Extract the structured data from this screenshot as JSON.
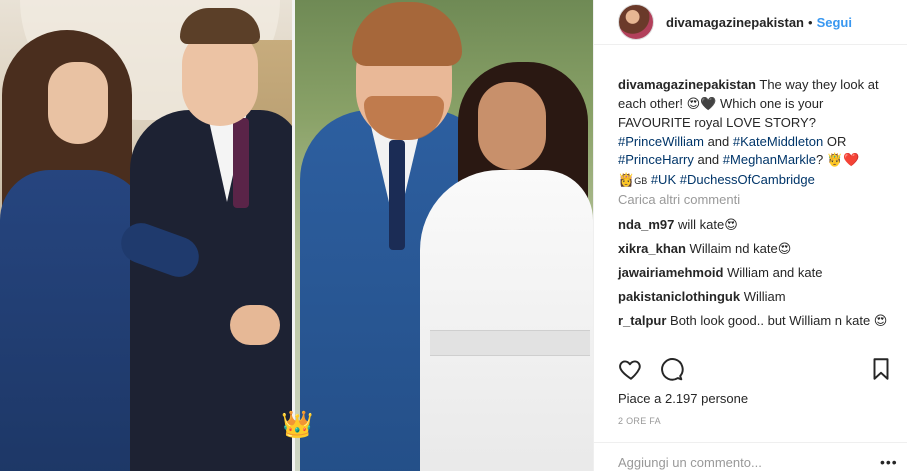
{
  "post": {
    "username": "divamagazinepakistan",
    "dot": "•",
    "follow_label": "Segui",
    "crown_emoji": "👑"
  },
  "caption": {
    "username": "divamagazinepakistan",
    "text_1": " The way they look at each other! ",
    "emoji_1": "😍🖤",
    "text_2": " Which one is your FAVOURITE royal LOVE STORY? ",
    "tag_1": "#PrinceWilliam",
    "text_3": " and ",
    "tag_2": "#KateMiddleton",
    "text_4": " OR ",
    "tag_3": "#PrinceHarry",
    "text_5": " and ",
    "tag_4": "#MeghanMarkle",
    "text_6": "? ",
    "emoji_2": "🤴❤️",
    "emoji_3": "👸",
    "flag_text": "GB",
    "tag_5": "#UK",
    "tag_6": "#DuchessOfCambridge"
  },
  "load_more": "Carica altri commenti",
  "comments": [
    {
      "user": "nda_m97",
      "text": " will kate",
      "emoji": "😍"
    },
    {
      "user": "xikra_khan",
      "text": " Willaim nd kate",
      "emoji": "😍"
    },
    {
      "user": "jawairiamehmoid",
      "text": " William and kate",
      "emoji": ""
    },
    {
      "user": "pakistaniclothinguk",
      "text": " William",
      "emoji": ""
    },
    {
      "user": "r_talpur",
      "text": " Both look good.. but William n kate ",
      "emoji": "😍"
    }
  ],
  "likes_text": "Piace a 2.197 persone",
  "timestamp": "2 ORE FA",
  "add_comment_placeholder": "Aggiungi un commento...",
  "more_options": "•••",
  "icons": {
    "like": "heart-icon",
    "comment": "comment-icon",
    "save": "bookmark-icon"
  }
}
